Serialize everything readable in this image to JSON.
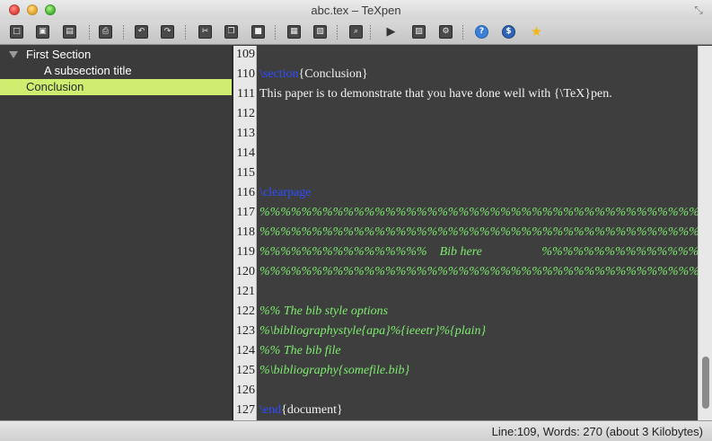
{
  "window": {
    "title": "abc.tex – TeXpen"
  },
  "toolbar": {
    "buttons": [
      {
        "icon": "new-file-icon",
        "glyph": "□"
      },
      {
        "icon": "open-file-icon",
        "glyph": "▣"
      },
      {
        "icon": "save-file-icon",
        "glyph": "▤"
      },
      {
        "icon": "print-icon",
        "glyph": "⎙"
      },
      {
        "icon": "undo-icon",
        "glyph": "↶"
      },
      {
        "icon": "redo-icon",
        "glyph": "↷"
      },
      {
        "icon": "cut-icon",
        "glyph": "✂"
      },
      {
        "icon": "copy-icon",
        "glyph": "❐"
      },
      {
        "icon": "paste-icon",
        "glyph": "■"
      },
      {
        "icon": "table-icon",
        "glyph": "▦"
      },
      {
        "icon": "image-icon",
        "glyph": "▧"
      },
      {
        "icon": "search-icon",
        "glyph": "⌕"
      },
      {
        "icon": "play-icon",
        "glyph": "▶"
      },
      {
        "icon": "typeset-icon",
        "glyph": "▨"
      },
      {
        "icon": "settings-icon",
        "glyph": "⚙"
      },
      {
        "icon": "help-icon",
        "glyph": "?"
      },
      {
        "icon": "donate-icon",
        "glyph": "$"
      },
      {
        "icon": "star-icon",
        "glyph": "★"
      }
    ]
  },
  "outline": {
    "items": [
      {
        "label": "First Section",
        "level": 0,
        "expanded": true,
        "selected": false
      },
      {
        "label": "A subsection title",
        "level": 1,
        "selected": false
      },
      {
        "label": "Conclusion",
        "level": 0,
        "selected": true
      }
    ]
  },
  "colors": {
    "keyword": "#2f4dff",
    "comment": "#7dee6e",
    "selection": "#cfee6f",
    "editor_bg": "#3e3e3e"
  },
  "editor": {
    "lines": [
      {
        "num": "109",
        "segments": []
      },
      {
        "num": "110",
        "segments": [
          {
            "t": "\\section",
            "k": "kw"
          },
          {
            "t": "{Conclusion}",
            "k": ""
          }
        ]
      },
      {
        "num": "111",
        "segments": [
          {
            "t": "This paper is to demonstrate that you have done well with {\\TeX}pen.",
            "k": ""
          }
        ]
      },
      {
        "num": "112",
        "segments": []
      },
      {
        "num": "113",
        "segments": []
      },
      {
        "num": "114",
        "segments": []
      },
      {
        "num": "115",
        "segments": []
      },
      {
        "num": "116",
        "segments": [
          {
            "t": "\\clearpage",
            "k": "kw"
          }
        ]
      },
      {
        "num": "117",
        "segments": [
          {
            "t": "%%%%%%%%%%%%%%%%%%%%%%%%%%%%%%%%%%%%%%%%%%%%%%%%",
            "k": "cm"
          }
        ]
      },
      {
        "num": "118",
        "segments": [
          {
            "t": "%%%%%%%%%%%%%%%%%%%%%%%%%%%%%%%%%%%%%%%%%%%%%%%%",
            "k": "cm"
          }
        ]
      },
      {
        "num": "119",
        "segments": [
          {
            "t": "%%%%%%%%%%%%%%%%    Bib here                   %%%%%%%%%%%%%%%%%%",
            "k": "cm"
          }
        ]
      },
      {
        "num": "120",
        "segments": [
          {
            "t": "%%%%%%%%%%%%%%%%%%%%%%%%%%%%%%%%%%%%%%%%%%%%%%%%",
            "k": "cm"
          }
        ]
      },
      {
        "num": "121",
        "segments": []
      },
      {
        "num": "122",
        "segments": [
          {
            "t": "%% The bib style options",
            "k": "cm"
          }
        ]
      },
      {
        "num": "123",
        "segments": [
          {
            "t": "%\\bibliographystyle{apa}%{ieeetr}%{plain}",
            "k": "cm"
          }
        ]
      },
      {
        "num": "124",
        "segments": [
          {
            "t": "%% The bib file",
            "k": "cm"
          }
        ]
      },
      {
        "num": "125",
        "segments": [
          {
            "t": "%\\bibliography{somefile.bib}",
            "k": "cm"
          }
        ]
      },
      {
        "num": "126",
        "segments": []
      },
      {
        "num": "127",
        "segments": [
          {
            "t": "\\end",
            "k": "kw"
          },
          {
            "t": "{document}",
            "k": ""
          }
        ]
      }
    ]
  },
  "status": {
    "text": "Line:109, Words: 270 (about 3 Kilobytes)"
  }
}
